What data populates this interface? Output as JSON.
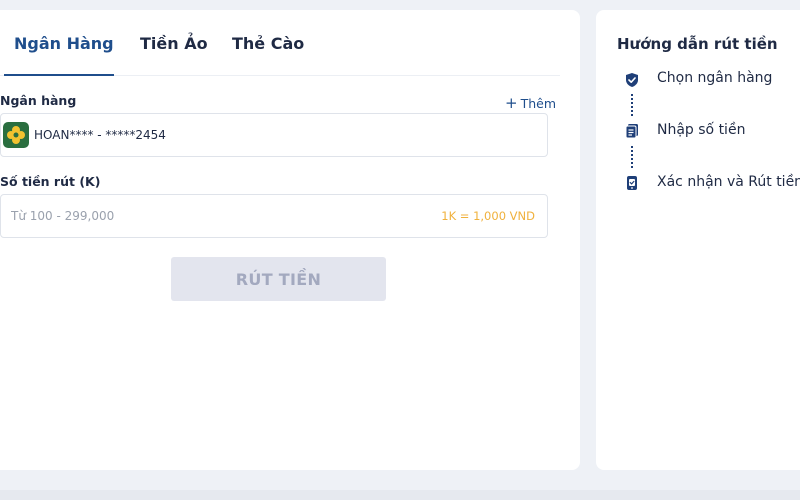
{
  "tabs": [
    {
      "label": "Ngân Hàng",
      "active": true
    },
    {
      "label": "Tiền Ảo",
      "active": false
    },
    {
      "label": "Thẻ Cào",
      "active": false
    }
  ],
  "bank_field": {
    "label": "Ngân hàng",
    "add_label": "Thêm",
    "add_icon": "+",
    "selected_value": "HOAN**** - *****2454"
  },
  "amount_field": {
    "label": "Số tiền rút (K)",
    "placeholder": "Từ 100 - 299,000",
    "rate_hint": "1K = 1,000 VND"
  },
  "submit_button": {
    "label": "RÚT TIỀN"
  },
  "guide": {
    "title": "Hướng dẫn rút tiền",
    "steps": [
      {
        "label": "Chọn ngân hàng",
        "icon": "shield-check-icon"
      },
      {
        "label": "Nhập số tiền",
        "icon": "document-icon"
      },
      {
        "label": "Xác nhận và Rút tiền",
        "icon": "phone-confirm-icon"
      }
    ]
  },
  "colors": {
    "accent": "#1f4e8c",
    "rate_hint": "#f0b13c",
    "button_disabled_bg": "#e3e5ee",
    "button_disabled_text": "#a3a9bf",
    "bank_logo_bg": "#2a6e3f"
  }
}
